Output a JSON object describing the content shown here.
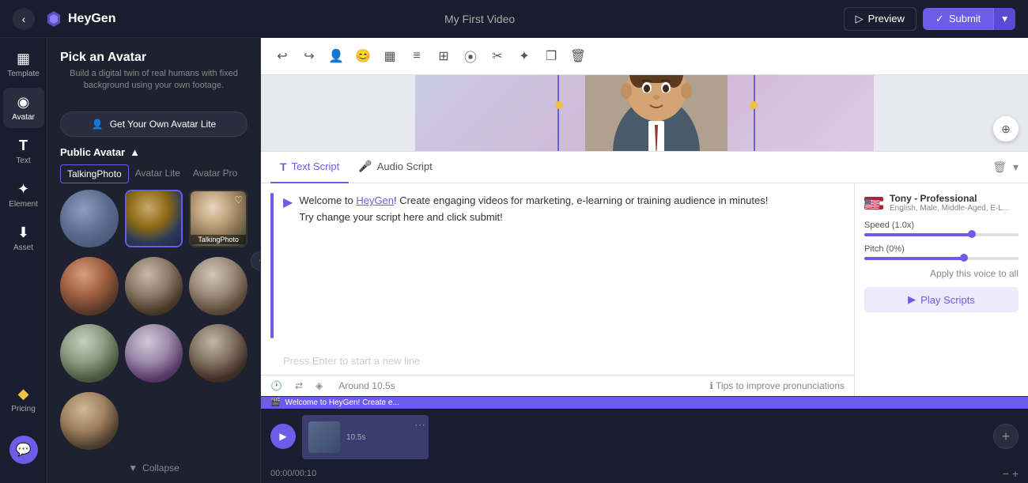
{
  "topbar": {
    "back_label": "‹",
    "logo_text": "HeyGen",
    "project_name": "My First Video",
    "preview_label": "Preview",
    "submit_label": "Submit",
    "submit_icon": "✓"
  },
  "icon_sidebar": {
    "items": [
      {
        "id": "template",
        "icon": "▦",
        "label": "Template",
        "active": false
      },
      {
        "id": "avatar",
        "icon": "◉",
        "label": "Avatar",
        "active": true
      },
      {
        "id": "text",
        "icon": "T",
        "label": "Text",
        "active": false
      },
      {
        "id": "element",
        "icon": "✦",
        "label": "Element",
        "active": false
      },
      {
        "id": "asset",
        "icon": "⬇",
        "label": "Asset",
        "active": false
      },
      {
        "id": "pricing",
        "icon": "◆",
        "label": "Pricing",
        "active": false
      },
      {
        "id": "chat",
        "icon": "💬",
        "label": "",
        "active": false
      }
    ]
  },
  "avatar_panel": {
    "title": "Pick an Avatar",
    "subtitle": "Build a digital twin of real humans with fixed background using your own footage.",
    "get_avatar_btn": "Get Your Own Avatar Lite",
    "public_avatar_label": "Public Avatar",
    "tabs": [
      {
        "id": "talking-photo",
        "label": "TalkingPhoto",
        "active": true
      },
      {
        "id": "avatar-lite",
        "label": "Avatar Lite",
        "active": false
      },
      {
        "id": "avatar-pro",
        "label": "Avatar Pro",
        "active": false
      }
    ],
    "collapse_label": "Collapse"
  },
  "toolbar": {
    "buttons": [
      "↩",
      "↪",
      "👤",
      "😊",
      "▦",
      "≡",
      "⊞",
      "⦿",
      "✂",
      "✦",
      "❐",
      "🗑"
    ]
  },
  "script_panel": {
    "tabs": [
      {
        "id": "text-script",
        "label": "Text Script",
        "icon": "T",
        "active": true
      },
      {
        "id": "audio-script",
        "label": "Audio Script",
        "icon": "🎤",
        "active": false
      }
    ],
    "script_text_part1": "Welcome to ",
    "script_link": "HeyGen",
    "script_text_part2": "! Create engaging videos for marketing, e-learning or training audience in minutes!",
    "script_text_line2": "Try change your script here and click submit!",
    "placeholder": "Press Enter to start a new line",
    "voice": {
      "name": "Tony - Professional",
      "description": "English, Male, Middle-Aged, E-L...",
      "speed_label": "Speed (1.0x)",
      "speed_value": 70,
      "pitch_label": "Pitch (0%)",
      "pitch_value": 65
    },
    "play_scripts_label": "Play Scripts",
    "bottom": {
      "time_icon": "🕐",
      "translate_icon": "⇄",
      "ai_icon": "◈",
      "duration": "Around 10.5s",
      "tips_label": "Tips to improve pronunciations",
      "apply_voice": "Apply this voice to all"
    }
  },
  "timeline": {
    "play_icon": "▶",
    "clip_label": "Welcome to HeyGen! Create e...",
    "clip_duration": "10.5s",
    "time_display": "00:00/00:10",
    "add_icon": "+",
    "zoom_in": "+",
    "zoom_out": "−"
  }
}
